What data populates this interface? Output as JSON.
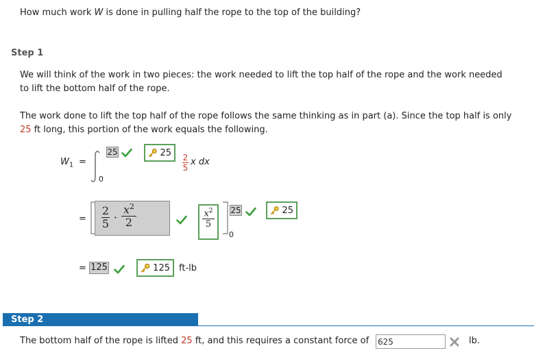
{
  "question": {
    "text_pre": "How much work ",
    "var": "W",
    "text_post": " is done in pulling half the rope to the top of the building?"
  },
  "step1": {
    "title": "Step 1",
    "para1_line1": "We will think of the work in two pieces: the work needed to lift the top half of the rope and the work needed",
    "para1_line2": "to lift the bottom half of the rope.",
    "para2_line1": "The work done to lift the top half of the rope follows the same thinking as in part (a). Since the top half is only",
    "para2_line2_num": "25",
    "para2_line2_rest": " ft long, this portion of the work equals the following.",
    "w1_label": "W",
    "w1_sub": "1",
    "equals": "=",
    "integral_lower": "0",
    "integral_upper_entered": "25",
    "integral_upper_key": "25",
    "integrand_num": "2",
    "integrand_den": "5",
    "integrand_rest": "x dx",
    "antideriv_frac_num": "2",
    "antideriv_frac_den": "5",
    "antideriv_dot": "·",
    "antideriv_x": "x",
    "antideriv_exp": "2",
    "antideriv_den2": "2",
    "key_x": "x",
    "key_exp": "2",
    "key_den": "5",
    "eval_upper_entered": "25",
    "eval_upper_key": "25",
    "eval_lower": "0",
    "result_entered": "125",
    "result_key": "125",
    "result_unit": "ft-lb"
  },
  "step2": {
    "title": "Step 2",
    "text_pre": "The bottom half of the rope is lifted ",
    "num": "25",
    "text_mid": " ft, and this requires a constant force of",
    "input_value": "625",
    "unit": "lb."
  },
  "colors": {
    "red": "#c0392b",
    "step2_header": "#1a6fb0",
    "check_green": "#3aa03a",
    "key_border": "#5aa05a",
    "wrong_gray": "#999999"
  }
}
